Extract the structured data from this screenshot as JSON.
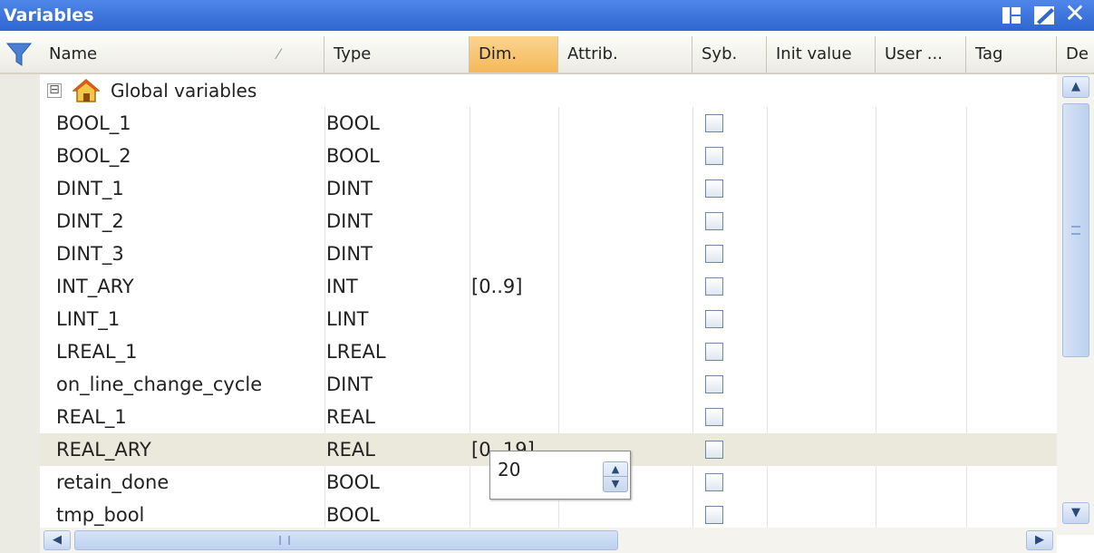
{
  "window": {
    "title": "Variables"
  },
  "columns": [
    "Name",
    "Type",
    "Dim.",
    "Attrib.",
    "Syb.",
    "Init value",
    "User ...",
    "Tag",
    "De"
  ],
  "group": {
    "label": "Global variables",
    "toggle_glyph": "⊟"
  },
  "rows": [
    {
      "name": "BOOL_1",
      "type": "BOOL",
      "dim": ""
    },
    {
      "name": "BOOL_2",
      "type": "BOOL",
      "dim": ""
    },
    {
      "name": "DINT_1",
      "type": "DINT",
      "dim": ""
    },
    {
      "name": "DINT_2",
      "type": "DINT",
      "dim": ""
    },
    {
      "name": "DINT_3",
      "type": "DINT",
      "dim": ""
    },
    {
      "name": "INT_ARY",
      "type": "INT",
      "dim": "[0..9]"
    },
    {
      "name": "LINT_1",
      "type": "LINT",
      "dim": ""
    },
    {
      "name": "LREAL_1",
      "type": "LREAL",
      "dim": ""
    },
    {
      "name": "on_line_change_cycle",
      "type": "DINT",
      "dim": ""
    },
    {
      "name": "REAL_1",
      "type": "REAL",
      "dim": ""
    },
    {
      "name": "REAL_ARY",
      "type": "REAL",
      "dim": "[0..19]"
    },
    {
      "name": "retain_done",
      "type": "BOOL",
      "dim": ""
    },
    {
      "name": "tmp_bool",
      "type": "BOOL",
      "dim": ""
    }
  ],
  "editor": {
    "value": "20"
  },
  "icons": {
    "filter": "filter-icon",
    "pin": "pin-icon",
    "edit": "edit-icon",
    "close": "close-icon",
    "home": "home-icon"
  },
  "colors": {
    "titlebar": "#2f66d1",
    "active_header": "#f5b85a",
    "selected_row": "#ebe9dc"
  }
}
